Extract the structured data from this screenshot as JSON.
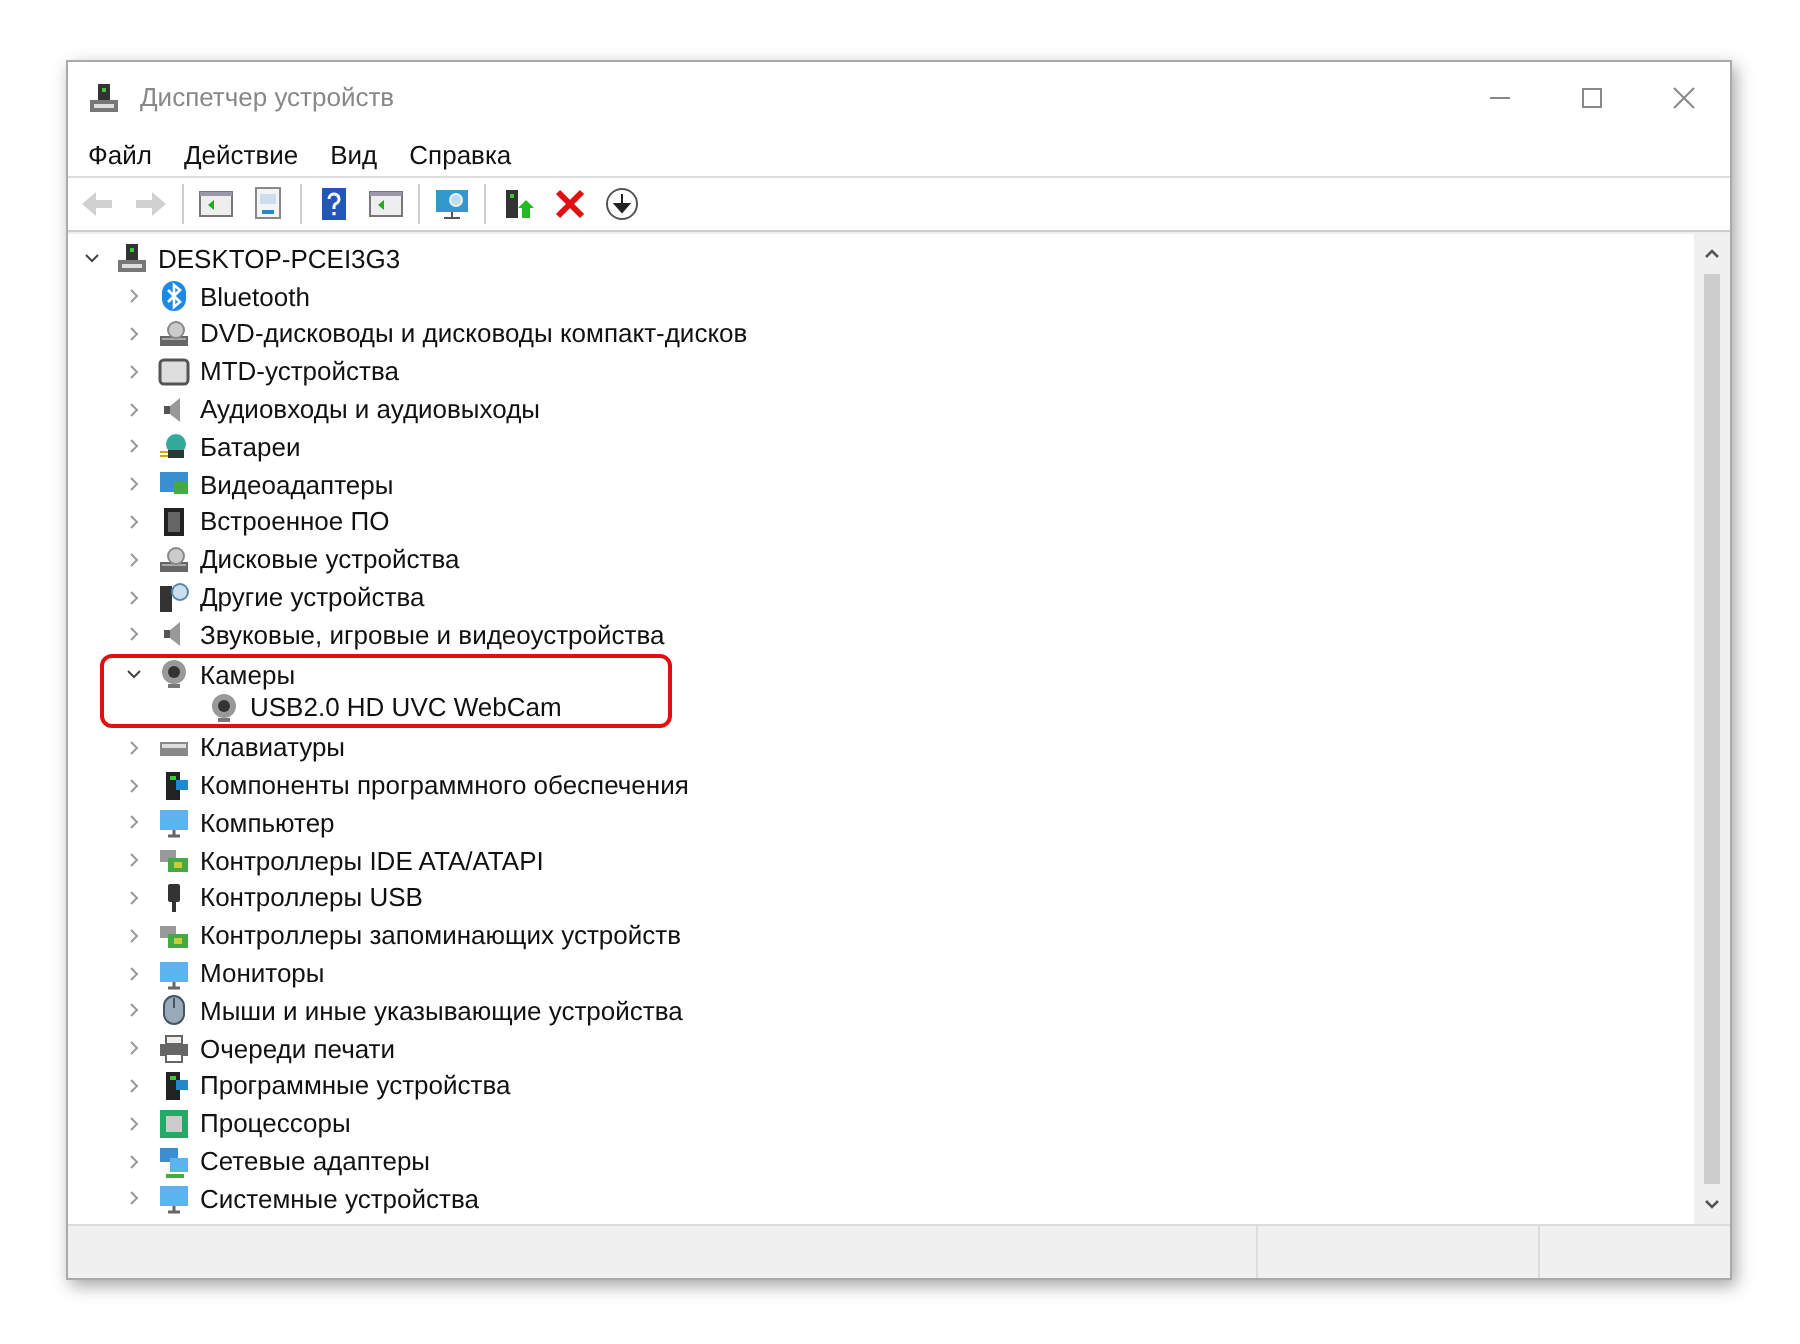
{
  "window": {
    "title": "Диспетчер устройств"
  },
  "menu": [
    "Файл",
    "Действие",
    "Вид",
    "Справка"
  ],
  "toolbar": [
    {
      "disabled": true
    },
    {
      "disabled": true
    },
    {
      "disabled": false
    },
    {
      "disabled": false
    },
    {
      "disabled": false
    },
    {
      "disabled": false
    },
    {
      "disabled": false
    },
    {
      "disabled": false
    },
    {
      "disabled": false
    },
    {
      "disabled": false
    }
  ],
  "tree": {
    "label": "DESKTOP-PCEI3G3",
    "expanded": true,
    "children": [
      {
        "label": "Bluetooth",
        "expanded": false,
        "highlighted": false
      },
      {
        "label": "DVD-дисководы и дисководы компакт-дисков",
        "expanded": false,
        "highlighted": false
      },
      {
        "label": "MTD-устройства",
        "expanded": false,
        "highlighted": false
      },
      {
        "label": "Аудиовходы и аудиовыходы",
        "expanded": false,
        "highlighted": false
      },
      {
        "label": "Батареи",
        "expanded": false,
        "highlighted": false
      },
      {
        "label": "Видеоадаптеры",
        "expanded": false,
        "highlighted": false
      },
      {
        "label": "Встроенное ПО",
        "expanded": false,
        "highlighted": false
      },
      {
        "label": "Дисковые устройства",
        "expanded": false,
        "highlighted": false
      },
      {
        "label": "Другие устройства",
        "expanded": false,
        "highlighted": false
      },
      {
        "label": "Звуковые, игровые и видеоустройства",
        "expanded": false,
        "highlighted": false
      },
      {
        "label": "Камеры",
        "expanded": true,
        "highlighted": true,
        "children": [
          {
            "label": "USB2.0 HD UVC WebCam"
          }
        ]
      },
      {
        "label": "Клавиатуры",
        "expanded": false,
        "highlighted": false
      },
      {
        "label": "Компоненты программного обеспечения",
        "expanded": false,
        "highlighted": false
      },
      {
        "label": "Компьютер",
        "expanded": false,
        "highlighted": false
      },
      {
        "label": "Контроллеры IDE ATA/ATAPI",
        "expanded": false,
        "highlighted": false
      },
      {
        "label": "Контроллеры USB",
        "expanded": false,
        "highlighted": false
      },
      {
        "label": "Контроллеры запоминающих устройств",
        "expanded": false,
        "highlighted": false
      },
      {
        "label": "Мониторы",
        "expanded": false,
        "highlighted": false
      },
      {
        "label": "Мыши и иные указывающие устройства",
        "expanded": false,
        "highlighted": false
      },
      {
        "label": "Очереди печати",
        "expanded": false,
        "highlighted": false
      },
      {
        "label": "Программные устройства",
        "expanded": false,
        "highlighted": false
      },
      {
        "label": "Процессоры",
        "expanded": false,
        "highlighted": false
      },
      {
        "label": "Сетевые адаптеры",
        "expanded": false,
        "highlighted": false
      },
      {
        "label": "Системные устройства",
        "expanded": false,
        "highlighted": false
      }
    ]
  }
}
